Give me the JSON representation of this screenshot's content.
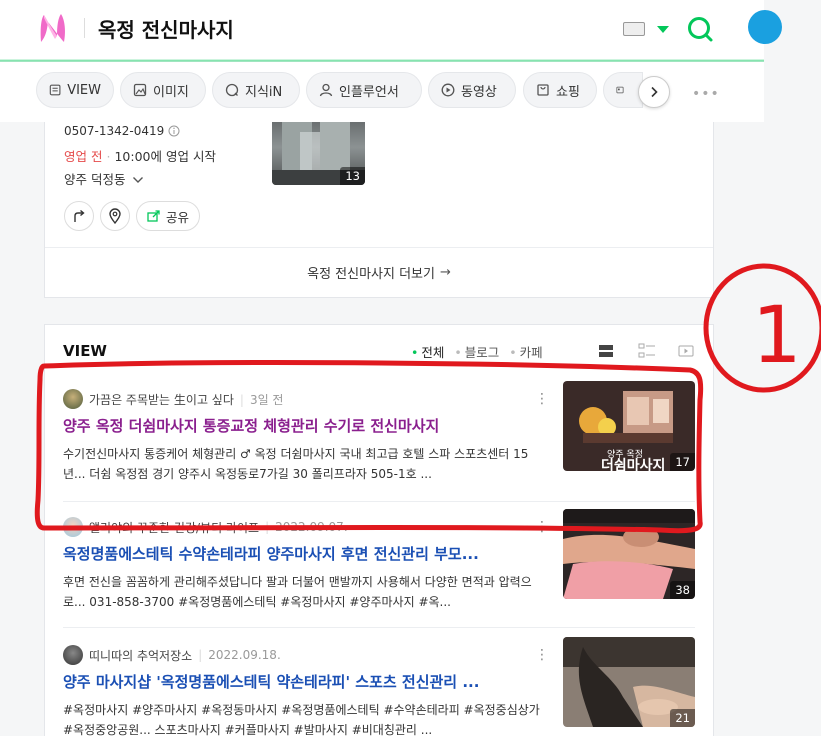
{
  "header": {
    "query": "옥정 전신마사지",
    "brand_color": "#03c75a"
  },
  "tabs": [
    {
      "label": "VIEW",
      "icon": "document-icon"
    },
    {
      "label": "이미지",
      "icon": "image-icon"
    },
    {
      "label": "지식iN",
      "icon": "qna-icon"
    },
    {
      "label": "인플루언서",
      "icon": "person-icon"
    },
    {
      "label": "동영상",
      "icon": "play-icon"
    },
    {
      "label": "쇼핑",
      "icon": "bag-icon"
    }
  ],
  "tabs_more": "•••",
  "place": {
    "phone": "0507-1342-0419",
    "status_closed": "영업 전",
    "status_open_time": "10:00에 영업 시작",
    "area": "양주 덕정동",
    "photo_count": "13",
    "share_label": "공유",
    "more_label": "옥정 전신마사지 더보기"
  },
  "view": {
    "title": "VIEW",
    "filters": {
      "all": "전체",
      "blog": "블로그",
      "cafe": "카페"
    },
    "posts": [
      {
        "author": "가끔은 주목받는 生이고 싶다",
        "date": "3일 전",
        "title": "양주 옥정 더쉼마사지 통증교정 체형관리 수기로 전신마사지",
        "snippet": "수기전신마사지 통증케어 체형관리 ♂ 옥정 더쉼마사지 국내 최고급 호텔 스파 스포츠센터 15년... 더쉼 옥정점 경기 양주시 옥정동로7가길 30 폴리프라자 505-1호 ...",
        "thumb_count": "17",
        "thumb_caption": "더쉼마사지",
        "thumb_sub": "양주 옥정"
      },
      {
        "author": "앨리야의 꾸준한 건강/뷰티 라이프",
        "date": "2022.09.07.",
        "title": "옥정명품에스테틱 수약손테라피 양주마사지 후면 전신관리 부모...",
        "snippet": "후면 전신을 꼼꼼하게 관리해주셨답니다 팔과 더불어 맨발까지 사용해서 다양한 면적과 압력으로... 031-858-3700 #옥정명품에스테틱 #옥정마사지 #양주마사지 #옥...",
        "thumb_count": "38"
      },
      {
        "author": "띠니따의 추억저장소",
        "date": "2022.09.18.",
        "title": "양주 마사지샵 '옥정명품에스테틱 약손테라피' 스포츠 전신관리 ...",
        "snippet": "#옥정마사지 #양주마사지 #옥정동마사지 #옥정명품에스테틱 #수약손테라피 #옥정중심상가 #옥정중앙공원... 스포츠마사지 #커플마사지 #발마사지 #비대칭관리 ...",
        "thumb_count": "21"
      }
    ]
  },
  "annotation": {
    "label": "1",
    "color": "#e0191e"
  }
}
